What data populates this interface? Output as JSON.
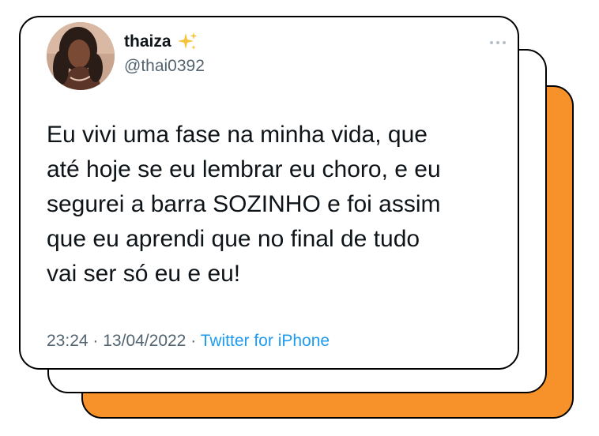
{
  "tweet": {
    "display_name": "thaiza",
    "handle": "@thai0392",
    "text_lines": [
      "Eu vivi uma fase na minha vida, que",
      "até hoje se eu lembrar eu choro, e eu",
      "segurei a barra SOZINHO e foi assim",
      "que eu aprendi que no final de tudo",
      "vai ser só eu e eu!"
    ],
    "time": "23:24",
    "date": "13/04/2022",
    "separator": "·",
    "source": "Twitter for iPhone"
  },
  "icons": {
    "name_emoji": "sparkles-icon",
    "menu": "more-options-icon"
  },
  "colors": {
    "back_card": "#f7922b",
    "source_link": "#1d9bf0",
    "secondary_text": "#536471",
    "primary_text": "#0f1419",
    "sparkles": "#f5c33b"
  }
}
